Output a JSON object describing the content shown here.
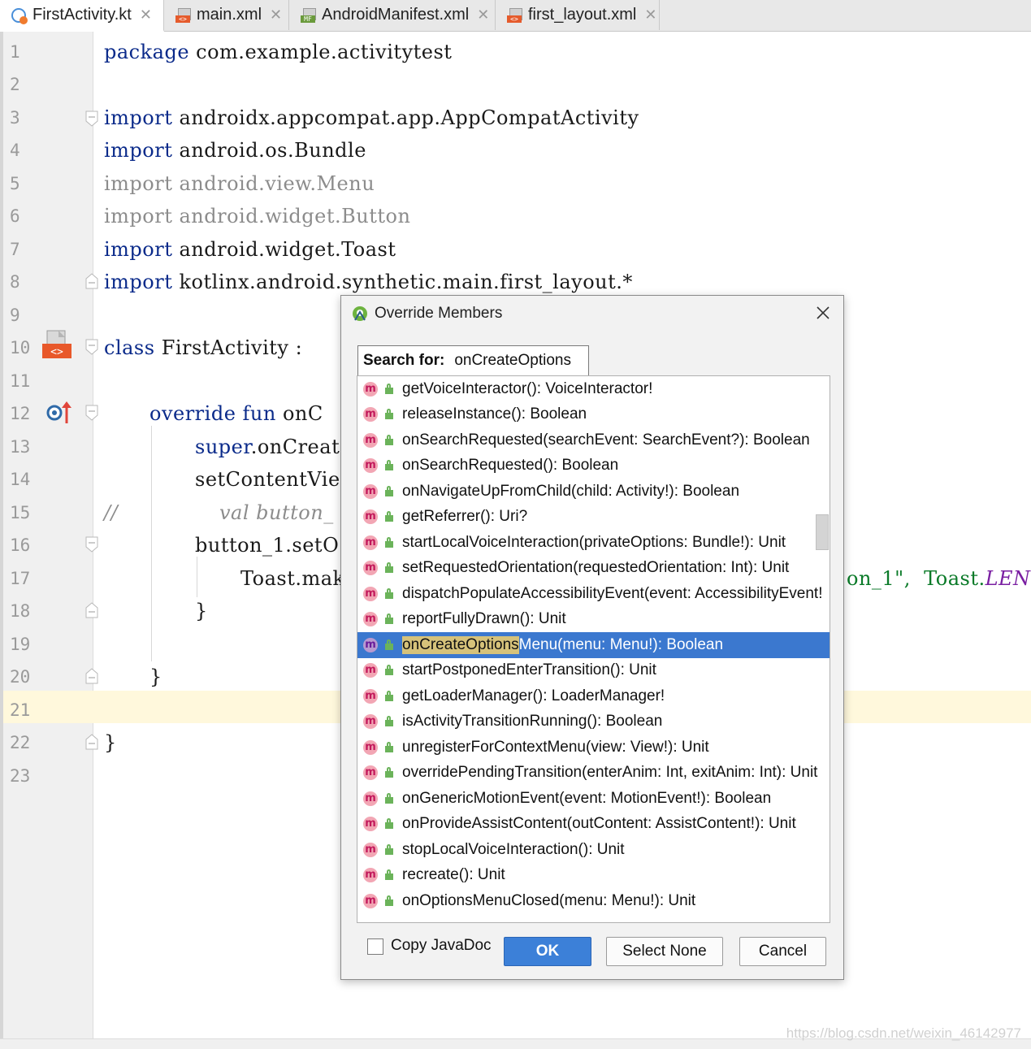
{
  "tabs": [
    {
      "label": "FirstActivity.kt",
      "icon": "kotlin-file-icon",
      "active": true
    },
    {
      "label": "main.xml",
      "icon": "xml-file-icon",
      "active": false
    },
    {
      "label": "AndroidManifest.xml",
      "icon": "manifest-file-icon",
      "active": false
    },
    {
      "label": "first_layout.xml",
      "icon": "xml-file-icon",
      "active": false
    }
  ],
  "editor": {
    "line_numbers": [
      "1",
      "2",
      "3",
      "4",
      "5",
      "6",
      "7",
      "8",
      "9",
      "10",
      "11",
      "12",
      "13",
      "14",
      "15",
      "16",
      "17",
      "18",
      "19",
      "20",
      "21",
      "22",
      "23"
    ],
    "current_line": "21",
    "lines": {
      "l1_kw": "package",
      "l1_rest": " com.example.activitytest",
      "l3_kw": "import",
      "l3_rest": " androidx.appcompat.app.AppCompatActivity",
      "l4_kw": "import",
      "l4_rest": " android.os.Bundle",
      "l5": "import android.view.Menu",
      "l6": "import android.widget.Button",
      "l7_kw": "import",
      "l7_rest": " android.widget.Toast",
      "l8_kw": "import",
      "l8_rest": " kotlinx.android.synthetic.main.first_layout.*",
      "l10_kw": "class",
      "l10_rest": " FirstActivity :",
      "l12_kw": "override fun",
      "l12_rest": " onC",
      "l13_kw": "super",
      "l13_rest": ".onCreat",
      "l14": "setContentVie",
      "l15_comment": "//",
      "l15_rest": "val button_",
      "l16": "button_1.setO",
      "l17_left": "Toast.mak",
      "l17_right": "on_1\",  Toast.",
      "l17_const": "LEN",
      "l18": "}",
      "l20": "}",
      "l22": "}"
    }
  },
  "dialog": {
    "title": "Override Members",
    "search_label": "Search for:",
    "search_value": "onCreateOptions",
    "items": [
      {
        "text": "getVoiceInteractor(): VoiceInteractor!"
      },
      {
        "text": "releaseInstance(): Boolean"
      },
      {
        "text": "onSearchRequested(searchEvent: SearchEvent?): Boolean"
      },
      {
        "text": "onSearchRequested(): Boolean"
      },
      {
        "text": "onNavigateUpFromChild(child: Activity!): Boolean"
      },
      {
        "text": "getReferrer(): Uri?"
      },
      {
        "text": "startLocalVoiceInteraction(privateOptions: Bundle!): Unit"
      },
      {
        "text": "setRequestedOrientation(requestedOrientation: Int): Unit"
      },
      {
        "text": "dispatchPopulateAccessibilityEvent(event: AccessibilityEvent!"
      },
      {
        "text": "reportFullyDrawn(): Unit"
      },
      {
        "match": "onCreateOptions",
        "rest": "Menu(menu: Menu!): Boolean",
        "selected": true
      },
      {
        "text": "startPostponedEnterTransition(): Unit"
      },
      {
        "text": "getLoaderManager(): LoaderManager!"
      },
      {
        "text": "isActivityTransitionRunning(): Boolean"
      },
      {
        "text": "unregisterForContextMenu(view: View!): Unit"
      },
      {
        "text": "overridePendingTransition(enterAnim: Int, exitAnim: Int): Unit"
      },
      {
        "text": "onGenericMotionEvent(event: MotionEvent!): Boolean"
      },
      {
        "text": "onProvideAssistContent(outContent: AssistContent!): Unit"
      },
      {
        "text": "stopLocalVoiceInteraction(): Unit"
      },
      {
        "text": "recreate(): Unit"
      },
      {
        "text": "onOptionsMenuClosed(menu: Menu!): Unit"
      }
    ],
    "method_badge": "m",
    "copy_javadoc_label": "Copy JavaDoc",
    "copy_javadoc_checked": false,
    "ok_label": "OK",
    "select_none_label": "Select None",
    "cancel_label": "Cancel"
  },
  "watermark": "https://blog.csdn.net/weixin_46142977",
  "colors": {
    "selection": "#3b78cf",
    "keyword": "#0a2a8a",
    "match_highlight": "#d6c27a",
    "current_line": "#fff8dc"
  }
}
